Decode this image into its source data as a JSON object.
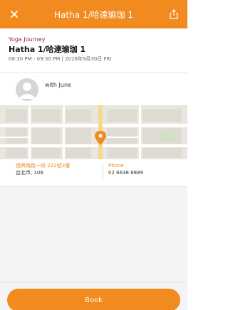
{
  "header": {
    "title": "Hatha 1/哈達瑜珈 1",
    "accent_color": "#f18a1f",
    "close_icon": "close-icon",
    "share_icon": "share-icon"
  },
  "event": {
    "category": "Yoga Journey",
    "title": "Hatha 1/哈達瑜珈 1",
    "time": "08:30 PM - 09:30 PM | 2016年9月30日 FRI"
  },
  "instructor": {
    "label": "with June"
  },
  "location": {
    "address_line1": "復興南路一段 222號3樓",
    "address_line2": "台北市, 106",
    "phone_label": "Phone",
    "phone_value": "02 6638 8889"
  },
  "actions": {
    "book_label": "Book"
  }
}
